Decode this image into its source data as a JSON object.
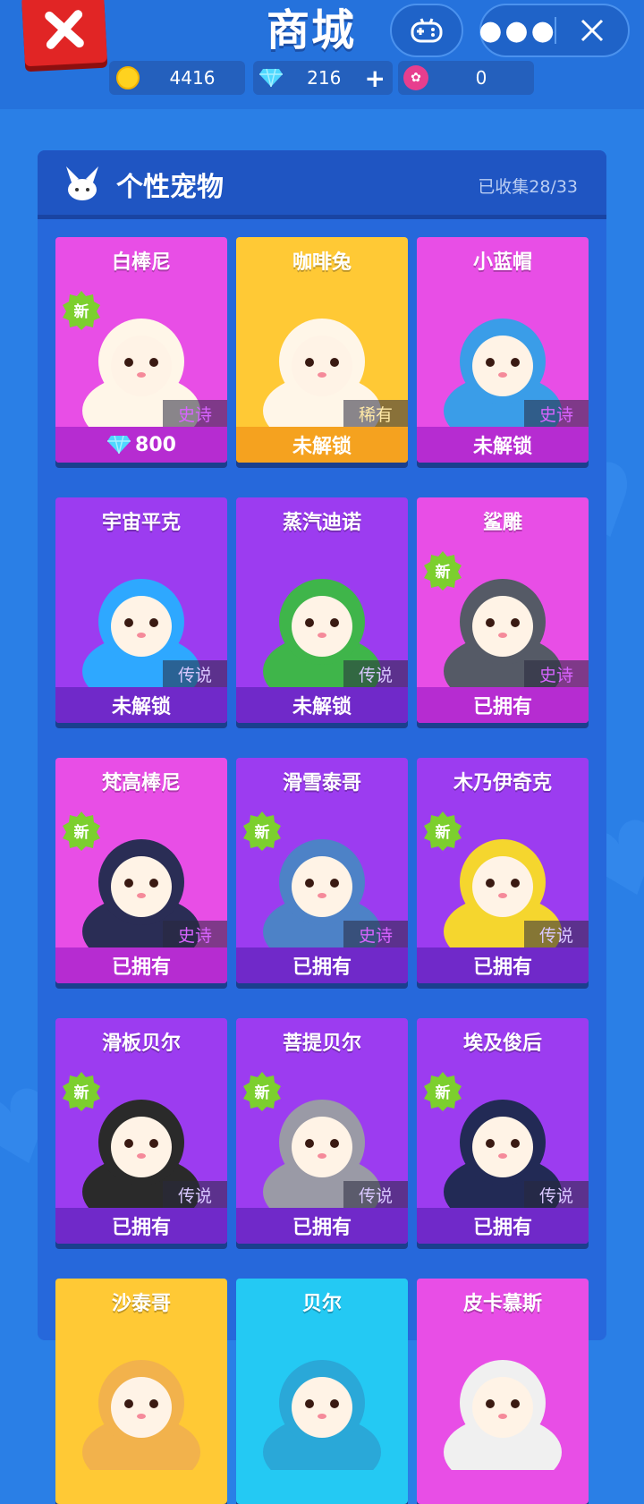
{
  "header": {
    "title": "商城",
    "currencies": [
      {
        "icon": "coin-icon",
        "value": "4416"
      },
      {
        "icon": "diamond-icon",
        "value": "216"
      },
      {
        "icon": "token-icon",
        "value": "0"
      }
    ]
  },
  "panel": {
    "title": "个性宠物",
    "collected": "已收集28/33"
  },
  "pets": [
    {
      "name": "白棒尼",
      "rarity": "史诗",
      "status": "800",
      "is_new": true,
      "new_label": "新"
    },
    {
      "name": "咖啡兔",
      "rarity": "稀有",
      "status": "未解锁",
      "is_new": false
    },
    {
      "name": "小蓝帽",
      "rarity": "史诗",
      "status": "未解锁",
      "is_new": false
    },
    {
      "name": "宇宙平克",
      "rarity": "传说",
      "status": "未解锁",
      "is_new": false
    },
    {
      "name": "蒸汽迪诺",
      "rarity": "传说",
      "status": "未解锁",
      "is_new": false
    },
    {
      "name": "鲨雕",
      "rarity": "史诗",
      "status": "已拥有",
      "is_new": true,
      "new_label": "新"
    },
    {
      "name": "梵高棒尼",
      "rarity": "史诗",
      "status": "已拥有",
      "is_new": true,
      "new_label": "新"
    },
    {
      "name": "滑雪泰哥",
      "rarity": "史诗",
      "status": "已拥有",
      "is_new": true,
      "new_label": "新"
    },
    {
      "name": "木乃伊奇克",
      "rarity": "传说",
      "status": "已拥有",
      "is_new": true,
      "new_label": "新"
    },
    {
      "name": "滑板贝尔",
      "rarity": "传说",
      "status": "已拥有",
      "is_new": true,
      "new_label": "新"
    },
    {
      "name": "菩提贝尔",
      "rarity": "传说",
      "status": "已拥有",
      "is_new": true,
      "new_label": "新"
    },
    {
      "name": "埃及俊后",
      "rarity": "传说",
      "status": "已拥有",
      "is_new": true,
      "new_label": "新"
    },
    {
      "name": "沙泰哥"
    },
    {
      "name": "贝尔"
    },
    {
      "name": "皮卡慕斯"
    }
  ]
}
